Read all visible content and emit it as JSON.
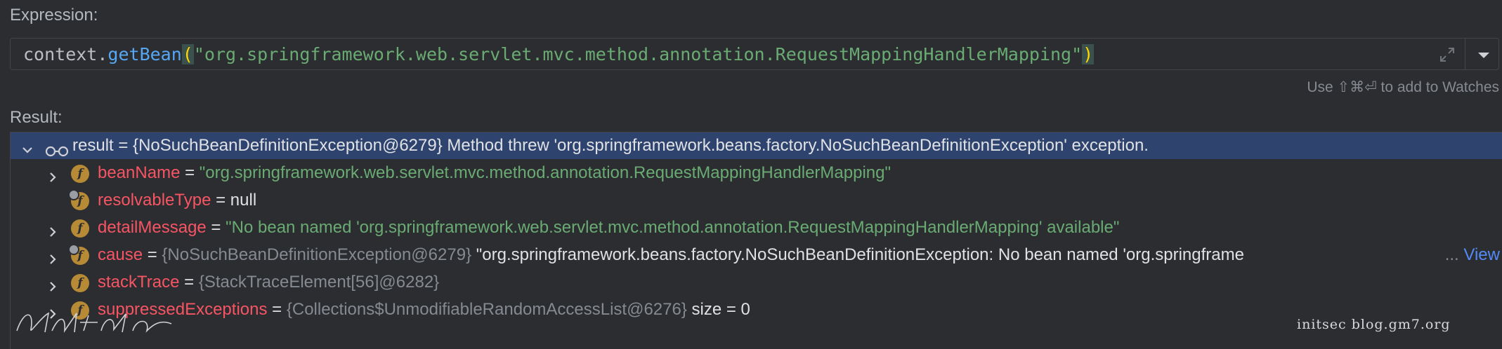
{
  "expression_label": "Expression:",
  "expression": {
    "receiver": "context.",
    "method": "getBean",
    "open_paren": "(",
    "argument": "\"org.springframework.web.servlet.mvc.method.annotation.RequestMappingHandlerMapping\"",
    "close_paren": ")"
  },
  "icons": {
    "expand": "expand-icon",
    "dropdown": "chevron-down-icon"
  },
  "watches_hint": "Use ⇧⌘⏎ to add to Watches",
  "result_label": "Result:",
  "tree": {
    "root": {
      "name": "result",
      "eq": " = ",
      "value": "{NoSuchBeanDefinitionException@6279} Method threw 'org.springframework.beans.factory.NoSuchBeanDefinitionException' exception."
    },
    "fields": [
      {
        "badge": "f",
        "name": "beanName",
        "eq": " = ",
        "value": "\"org.springframework.web.servlet.mvc.method.annotation.RequestMappingHandlerMapping\""
      },
      {
        "badge": "f",
        "name": "resolvableType",
        "eq": " = ",
        "value": "null"
      },
      {
        "badge": "f",
        "name": "detailMessage",
        "eq": " = ",
        "value": "\"No bean named 'org.springframework.web.servlet.mvc.method.annotation.RequestMappingHandlerMapping' available\""
      },
      {
        "badge": "f",
        "name": "cause",
        "eq": " = ",
        "ref": "{NoSuchBeanDefinitionException@6279}",
        "value": " \"org.springframework.beans.factory.NoSuchBeanDefinitionException: No bean named 'org.springframe",
        "ellipsis": "...",
        "link": " View"
      },
      {
        "badge": "f",
        "name": "stackTrace",
        "eq": " = ",
        "ref": "{StackTraceElement[56]@6282}"
      },
      {
        "badge": "f",
        "name": "suppressedExceptions",
        "eq": " = ",
        "ref": "{Collections$UnmodifiableRandomAccessList@6276}",
        "value": "  size = 0"
      }
    ]
  },
  "watermark": "initsec blog.gm7.org",
  "colors": {
    "background": "#2b2d30",
    "selection": "#2e436e",
    "field_name": "#f75464",
    "string": "#6aab73",
    "method": "#56a8f5",
    "badge": "#b78a36",
    "link": "#548af7"
  }
}
